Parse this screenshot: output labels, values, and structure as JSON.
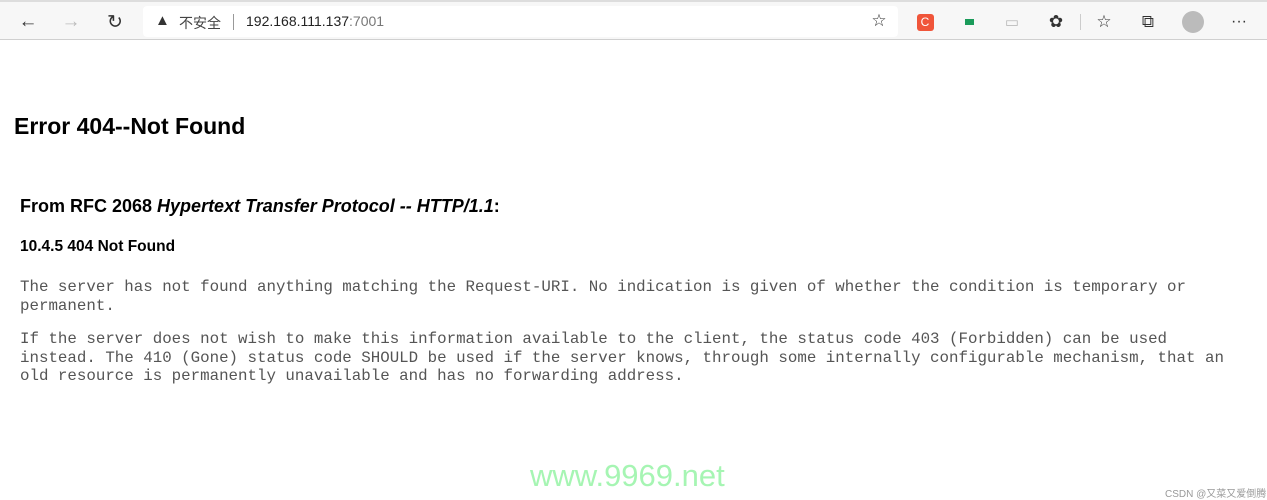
{
  "browser": {
    "security_label": "不安全",
    "url_host": "192.168.111.137",
    "url_port": ":7001",
    "icons": [
      "back-icon",
      "forward-icon",
      "refresh-icon",
      "warning-icon",
      "favorite-add-icon",
      "csdn-extension-icon",
      "extension-green-icon",
      "extension-gray-icon",
      "extensions-icon",
      "favorites-icon",
      "collections-icon",
      "profile-avatar-icon",
      "more-icon"
    ],
    "csdn_ext_letter": "C"
  },
  "page": {
    "title": "Error 404--Not Found",
    "rfc_prefix": "From RFC 2068 ",
    "rfc_title": "Hypertext Transfer Protocol -- HTTP/1.1",
    "rfc_suffix": ":",
    "section": "10.4.5 404 Not Found",
    "para1": "The server has not found anything matching the Request-URI. No indication is given of whether the condition is temporary or\npermanent.",
    "para2": "If the server does not wish to make this information available to the client, the status code 403 (Forbidden) can be used\ninstead. The 410 (Gone) status code SHOULD be used if the server knows, through some internally configurable mechanism, that an\nold resource is permanently unavailable and has no forwarding address."
  },
  "watermarks": {
    "site": "www.9969.net",
    "csdn": "CSDN @又菜又爱倒腾"
  }
}
